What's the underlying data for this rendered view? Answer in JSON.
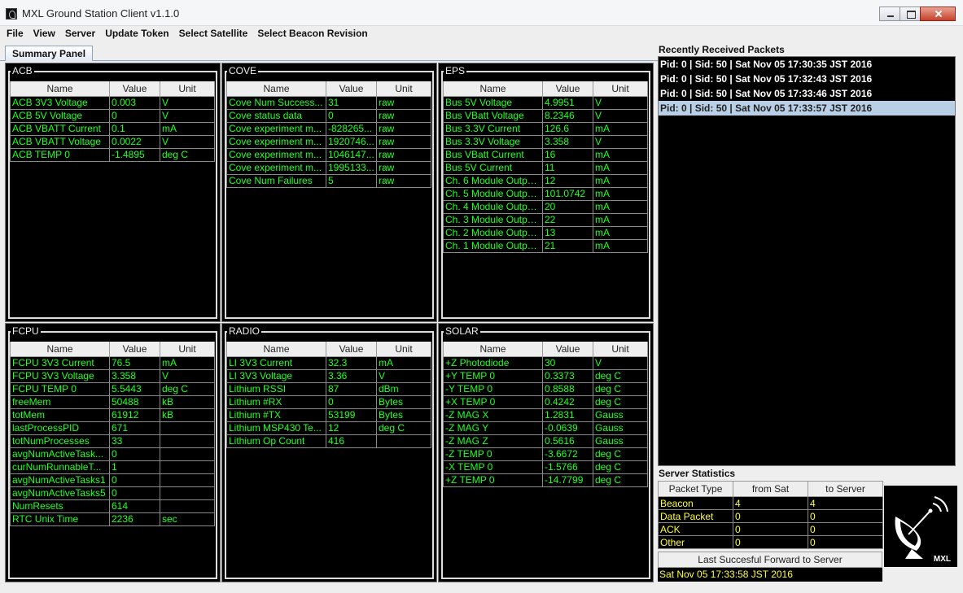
{
  "window": {
    "title": "MXL Ground Station Client v1.1.0"
  },
  "menu": [
    "File",
    "View",
    "Server",
    "Update Token",
    "Select Satellite",
    "Select Beacon Revision"
  ],
  "tab": {
    "label": "Summary Panel"
  },
  "columns": {
    "name": "Name",
    "value": "Value",
    "unit": "Unit"
  },
  "groups": {
    "acb": {
      "title": "ACB",
      "rows": [
        [
          "ACB 3V3 Voltage",
          "0.003",
          "V"
        ],
        [
          "ACB 5V Voltage",
          "0",
          "V"
        ],
        [
          "ACB VBATT Current",
          "0.1",
          "mA"
        ],
        [
          "ACB VBATT Voltage",
          "0.0022",
          "V"
        ],
        [
          "ACB TEMP 0",
          "-1.4895",
          "deg C"
        ]
      ]
    },
    "cove": {
      "title": "COVE",
      "rows": [
        [
          "Cove Num Success...",
          "31",
          "raw"
        ],
        [
          "Cove status data",
          "0",
          "raw"
        ],
        [
          "Cove experiment m...",
          "-828265...",
          "raw"
        ],
        [
          "Cove experiment m...",
          "1920746...",
          "raw"
        ],
        [
          "Cove experiment m...",
          "1046147...",
          "raw"
        ],
        [
          "Cove experiment m...",
          "1995133...",
          "raw"
        ],
        [
          "Cove Num Failures",
          "5",
          "raw"
        ]
      ]
    },
    "eps": {
      "title": "EPS",
      "rows": [
        [
          "Bus 5V Voltage",
          "4.9951",
          "V"
        ],
        [
          "Bus VBatt Voltage",
          "8.2346",
          "V"
        ],
        [
          "Bus 3.3V Current",
          "126.6",
          "mA"
        ],
        [
          "Bus 3.3V Voltage",
          "3.358",
          "V"
        ],
        [
          "Bus VBatt Current",
          "16",
          "mA"
        ],
        [
          "Bus 5V Current",
          "11",
          "mA"
        ],
        [
          "Ch. 6 Module Outpu...",
          "12",
          "mA"
        ],
        [
          "Ch. 5 Module Outpu...",
          "101.0742",
          "mA"
        ],
        [
          "Ch. 4 Module Outpu...",
          "20",
          "mA"
        ],
        [
          "Ch. 3 Module Outpu...",
          "22",
          "mA"
        ],
        [
          "Ch. 2 Module Outpu...",
          "13",
          "mA"
        ],
        [
          "Ch. 1 Module Outpu...",
          "21",
          "mA"
        ]
      ]
    },
    "fcpu": {
      "title": "FCPU",
      "rows": [
        [
          "FCPU 3V3 Current",
          "76.5",
          "mA"
        ],
        [
          "FCPU 3V3 Voltage",
          "3.358",
          "V"
        ],
        [
          "FCPU TEMP 0",
          "5.5443",
          "deg C"
        ],
        [
          "freeMem",
          "50488",
          "kB"
        ],
        [
          "totMem",
          "61912",
          "kB"
        ],
        [
          "lastProcessPID",
          "671",
          ""
        ],
        [
          "totNumProcesses",
          "33",
          ""
        ],
        [
          "avgNumActiveTask...",
          "0",
          ""
        ],
        [
          "curNumRunnableT...",
          "1",
          ""
        ],
        [
          "avgNumActiveTasks1",
          "0",
          ""
        ],
        [
          "avgNumActiveTasks5",
          "0",
          ""
        ],
        [
          "NumResets",
          "614",
          ""
        ],
        [
          "RTC Unix Time",
          "2236",
          "sec"
        ]
      ]
    },
    "radio": {
      "title": "RADIO",
      "rows": [
        [
          "LI 3V3 Current",
          "32.3",
          "mA"
        ],
        [
          "LI 3V3 Voltage",
          "3.36",
          "V"
        ],
        [
          "Lithium RSSI",
          "87",
          "dBm"
        ],
        [
          "Lithium #RX",
          "0",
          "Bytes"
        ],
        [
          "Lithium #TX",
          "53199",
          "Bytes"
        ],
        [
          "Lithium MSP430 Te...",
          "12",
          "deg C"
        ],
        [
          "Lithium Op Count",
          "416",
          ""
        ]
      ]
    },
    "solar": {
      "title": "SOLAR",
      "rows": [
        [
          "+Z Photodiode",
          "30",
          "V"
        ],
        [
          "+Y TEMP 0",
          "0.3373",
          "deg C"
        ],
        [
          "-Y TEMP 0",
          "0.8588",
          "deg C"
        ],
        [
          "+X TEMP 0",
          "0.4242",
          "deg C"
        ],
        [
          "-Z MAG X",
          "1.2831",
          "Gauss"
        ],
        [
          "-Z MAG Y",
          "-0.0639",
          "Gauss"
        ],
        [
          "-Z MAG Z",
          "0.5616",
          "Gauss"
        ],
        [
          "-Z TEMP 0",
          "-3.6672",
          "deg C"
        ],
        [
          "-X TEMP 0",
          "-1.5766",
          "deg C"
        ],
        [
          "+Z TEMP 0",
          "-14.7799",
          "deg C"
        ]
      ]
    }
  },
  "recent": {
    "title": "Recently Received Packets",
    "packets": [
      "Pid: 0 | Sid: 50 | Sat Nov 05 17:30:35 JST 2016",
      "Pid: 0 | Sid: 50 | Sat Nov 05 17:32:43 JST 2016",
      "Pid: 0 | Sid: 50 | Sat Nov 05 17:33:46 JST 2016",
      "Pid: 0 | Sid: 50 | Sat Nov 05 17:33:57 JST 2016"
    ],
    "selected_index": 3
  },
  "server_stats": {
    "title": "Server Statistics",
    "headers": [
      "Packet Type",
      "from Sat",
      "to Server"
    ],
    "rows": [
      [
        "Beacon",
        "4",
        "4"
      ],
      [
        "Data Packet",
        "0",
        "0"
      ],
      [
        "ACK",
        "0",
        "0"
      ],
      [
        "Other",
        "0",
        "0"
      ]
    ],
    "last_forward_label": "Last Succesful Forward to Server",
    "last_forward_value": "Sat Nov 05 17:33:58 JST 2016"
  },
  "logo": {
    "text": "MXL",
    "icon": "satellite-dish-icon"
  }
}
